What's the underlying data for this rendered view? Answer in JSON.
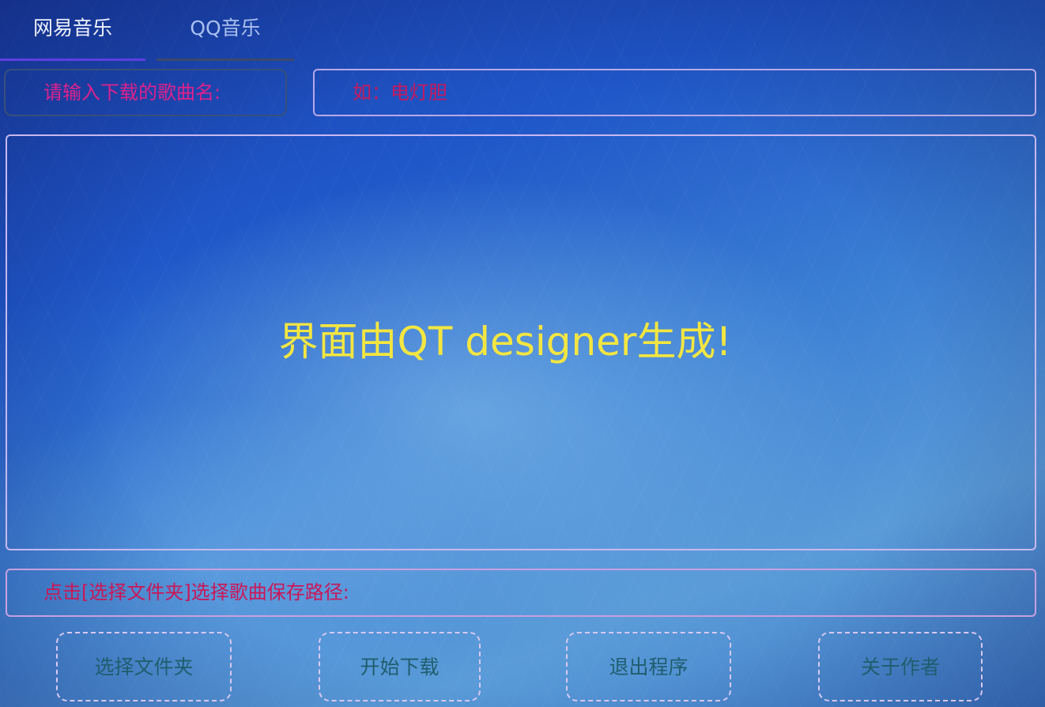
{
  "tabs": [
    {
      "label": "网易音乐",
      "active": true
    },
    {
      "label": "QQ音乐",
      "active": false
    }
  ],
  "search": {
    "prompt_label": "请输入下载的歌曲名:",
    "placeholder": "如：电灯胆",
    "value": ""
  },
  "main": {
    "message": "界面由QT designer生成!"
  },
  "save_path": {
    "label": "点击[选择文件夹]选择歌曲保存路径:"
  },
  "buttons": {
    "select_folder": "选择文件夹",
    "start_download": "开始下载",
    "exit_program": "退出程序",
    "about_author": "关于作者"
  },
  "colors": {
    "active_tab_underline": "#5d3fe0",
    "prompt_text": "#e0208c",
    "placeholder_text": "#c8195c",
    "main_message": "#f4e640",
    "path_label": "#cc1656",
    "button_text": "#1f5e6e"
  }
}
